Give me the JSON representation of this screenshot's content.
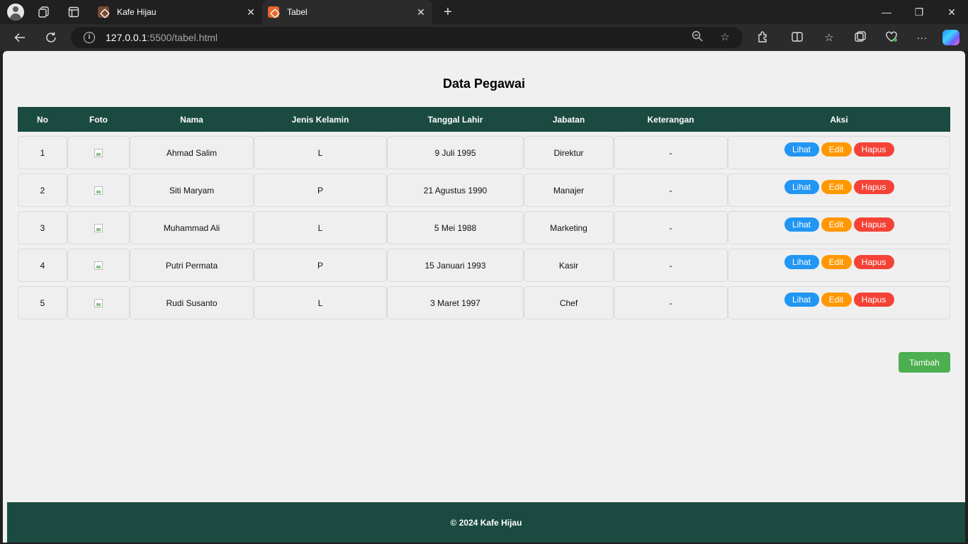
{
  "browser": {
    "tabs": [
      {
        "title": "Kafe Hijau",
        "active": false
      },
      {
        "title": "Tabel",
        "active": true
      }
    ],
    "url_host": "127.0.0.1",
    "url_rest": ":5500/tabel.html"
  },
  "page": {
    "title": "Data Pegawai",
    "columns": [
      "No",
      "Foto",
      "Nama",
      "Jenis Kelamin",
      "Tanggal Lahir",
      "Jabatan",
      "Keterangan",
      "Aksi"
    ],
    "rows": [
      {
        "no": "1",
        "nama": "Ahmad Salim",
        "jk": "L",
        "tgl": "9 Juli 1995",
        "jabatan": "Direktur",
        "ket": "-"
      },
      {
        "no": "2",
        "nama": "Siti Maryam",
        "jk": "P",
        "tgl": "21 Agustus 1990",
        "jabatan": "Manajer",
        "ket": "-"
      },
      {
        "no": "3",
        "nama": "Muhammad Ali",
        "jk": "L",
        "tgl": "5 Mei 1988",
        "jabatan": "Marketing",
        "ket": "-"
      },
      {
        "no": "4",
        "nama": "Putri Permata",
        "jk": "P",
        "tgl": "15 Januari 1993",
        "jabatan": "Kasir",
        "ket": "-"
      },
      {
        "no": "5",
        "nama": "Rudi Susanto",
        "jk": "L",
        "tgl": "3 Maret 1997",
        "jabatan": "Chef",
        "ket": "-"
      }
    ],
    "actions": {
      "view": "Lihat",
      "edit": "Edit",
      "delete": "Hapus"
    },
    "add_button": "Tambah",
    "footer": "© 2024 Kafe Hijau"
  },
  "colors": {
    "header_bg": "#1b4a40",
    "view": "#2196f3",
    "edit": "#ff9800",
    "delete": "#f44336",
    "add": "#4caf50"
  }
}
